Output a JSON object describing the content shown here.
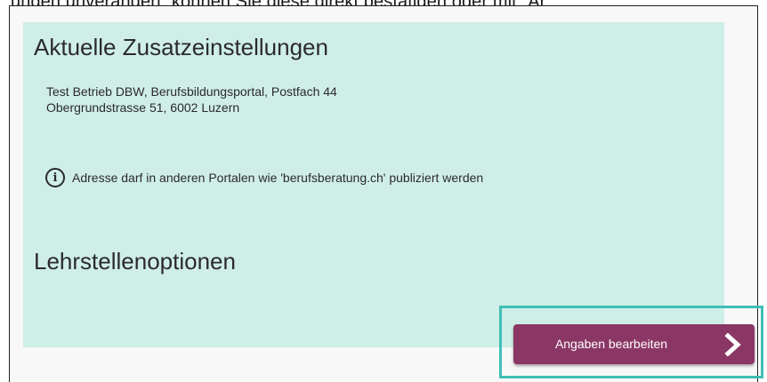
{
  "top_text": "ungen unverändert, können Sie diese direkt bestätigen oder mit “Ar",
  "panel": {
    "title": "Aktuelle Zusatzeinstellungen",
    "address_line1": "Test Betrieb DBW, Berufsbildungsportal, Postfach 44",
    "address_line2": "Obergrundstrasse 51, 6002 Luzern",
    "info_icon": "info-circle-icon",
    "info_text": "Adresse darf in anderen Portalen wie 'berufsberatung.ch' publiziert werden",
    "section_title": "Lehrstellenoptionen"
  },
  "button": {
    "label": "Angaben bearbeiten",
    "icon": "chevron-right-icon"
  },
  "colors": {
    "panel_bg": "#cfeee7",
    "button_bg": "#8b3765",
    "highlight_border": "#3fbfb6"
  }
}
